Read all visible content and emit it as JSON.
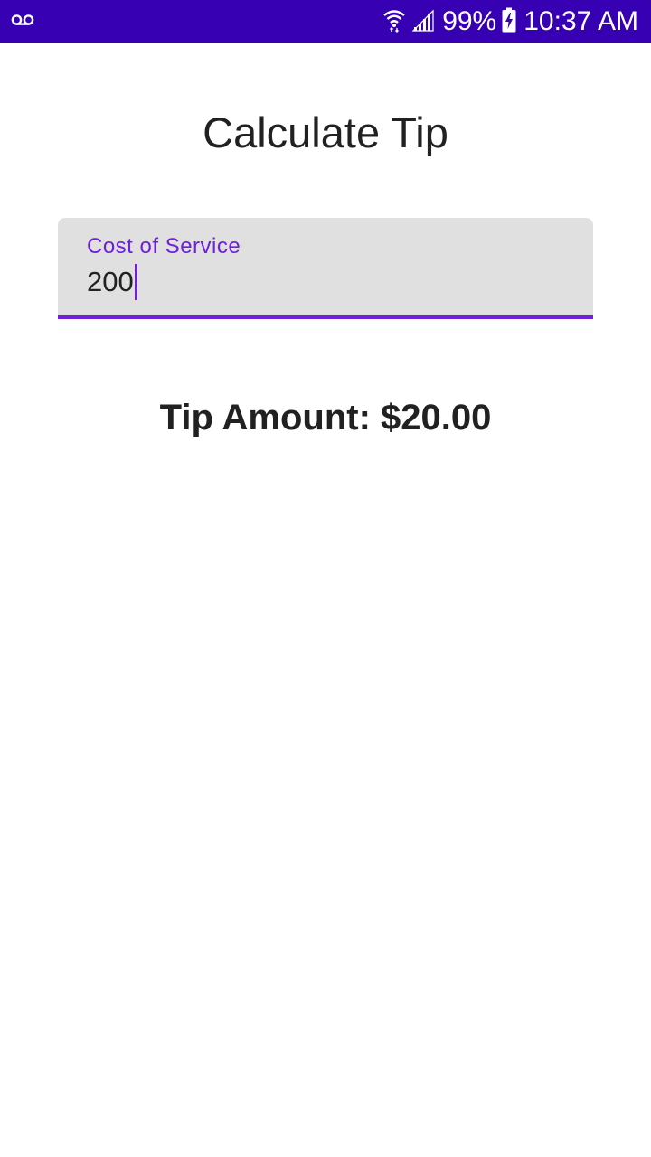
{
  "colors": {
    "status_bar": "#3700b3",
    "accent": "#7020d8",
    "field_background": "#e0e0e0",
    "text_primary": "#212121"
  },
  "status_bar": {
    "left_icons": [
      "voicemail-icon"
    ],
    "right_icons": [
      "wifi-icon",
      "cell-signal-icon",
      "battery-charging-icon"
    ],
    "battery_percent": "99%",
    "time": "10:37 AM"
  },
  "title": "Calculate Tip",
  "cost_field": {
    "label": "Cost of Service",
    "value": "200"
  },
  "tip_result": "Tip Amount: $20.00"
}
